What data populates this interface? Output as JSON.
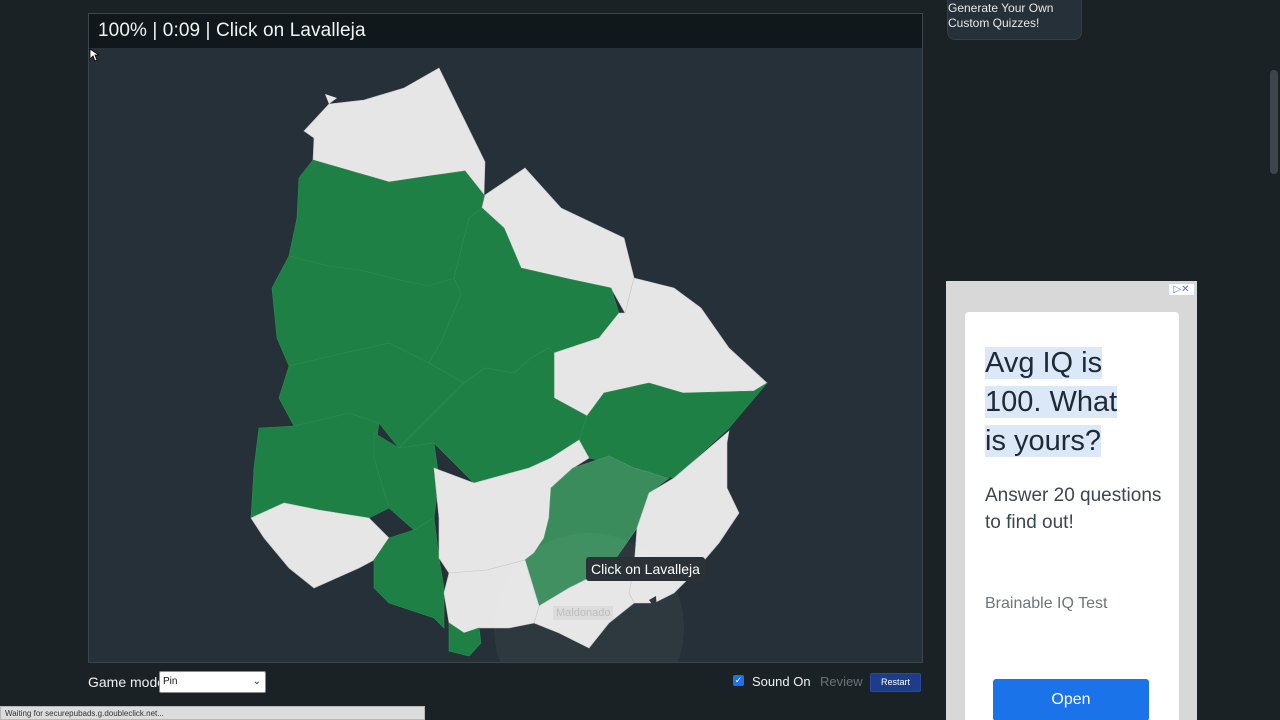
{
  "quiz": {
    "header_text": "100% | 0:09 | Click on Lavalleja",
    "tooltip": "Click on Lavalleja",
    "faint_label": "Maldonado"
  },
  "controls": {
    "game_mode_label": "Game mode:",
    "game_mode_value": "Pin",
    "sound_label": "Sound On",
    "sound_checked": true,
    "review_label": "Review",
    "restart_label": "Restart"
  },
  "promo": {
    "line1": "Generate Your Own",
    "line2": "Custom Quizzes!"
  },
  "ad": {
    "headline_lines": [
      "Avg IQ is",
      "100. What",
      "is yours?"
    ],
    "subtext": "Answer 20 questions to find out!",
    "brand": "Brainable IQ Test",
    "cta": "Open"
  },
  "status": {
    "text": "Waiting for securepubads.g.doubleclick.net..."
  },
  "colors": {
    "found": "#1f8045",
    "unfound": "#e6e6e6",
    "hover": "#3a8c5c",
    "panel_bg": "#263038",
    "page_bg": "#1b2226"
  }
}
